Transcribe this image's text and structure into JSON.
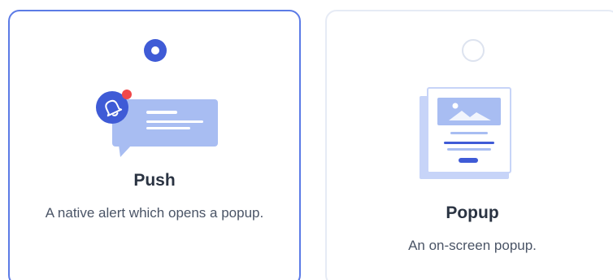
{
  "options": [
    {
      "title": "Push",
      "description": "A native alert which opens a popup.",
      "selected": true,
      "illustration": "push-notification-illustration"
    },
    {
      "title": "Popup",
      "description": "An on-screen popup.",
      "selected": false,
      "illustration": "popup-window-illustration"
    }
  ],
  "colors": {
    "accent": "#3f5bd6",
    "illustration_light": "#a8bdf2",
    "illustration_mid": "#c7d4f8",
    "notification_dot": "#f0484a"
  }
}
